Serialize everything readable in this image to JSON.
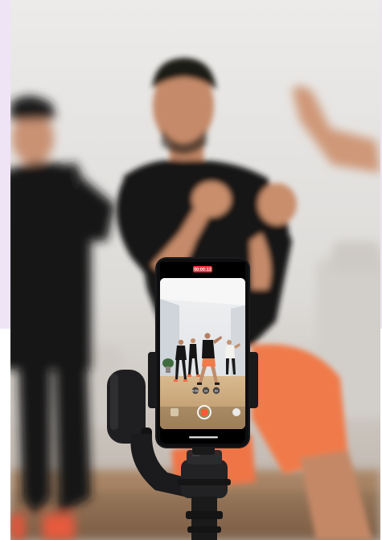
{
  "photo": {
    "recording_timer": "00:00:13",
    "zoom_options": [
      "0.5x",
      "1x",
      "2x"
    ],
    "colors": {
      "wall": "#e8e6e4",
      "shirt": "#171717",
      "shorts": "#f07a4a",
      "skin": "#c68a67",
      "floor": "#c9a77e",
      "phone_body": "#1b1b1d",
      "record_dot": "#ff5a36",
      "rec_badge": "#ef2f3b"
    }
  }
}
